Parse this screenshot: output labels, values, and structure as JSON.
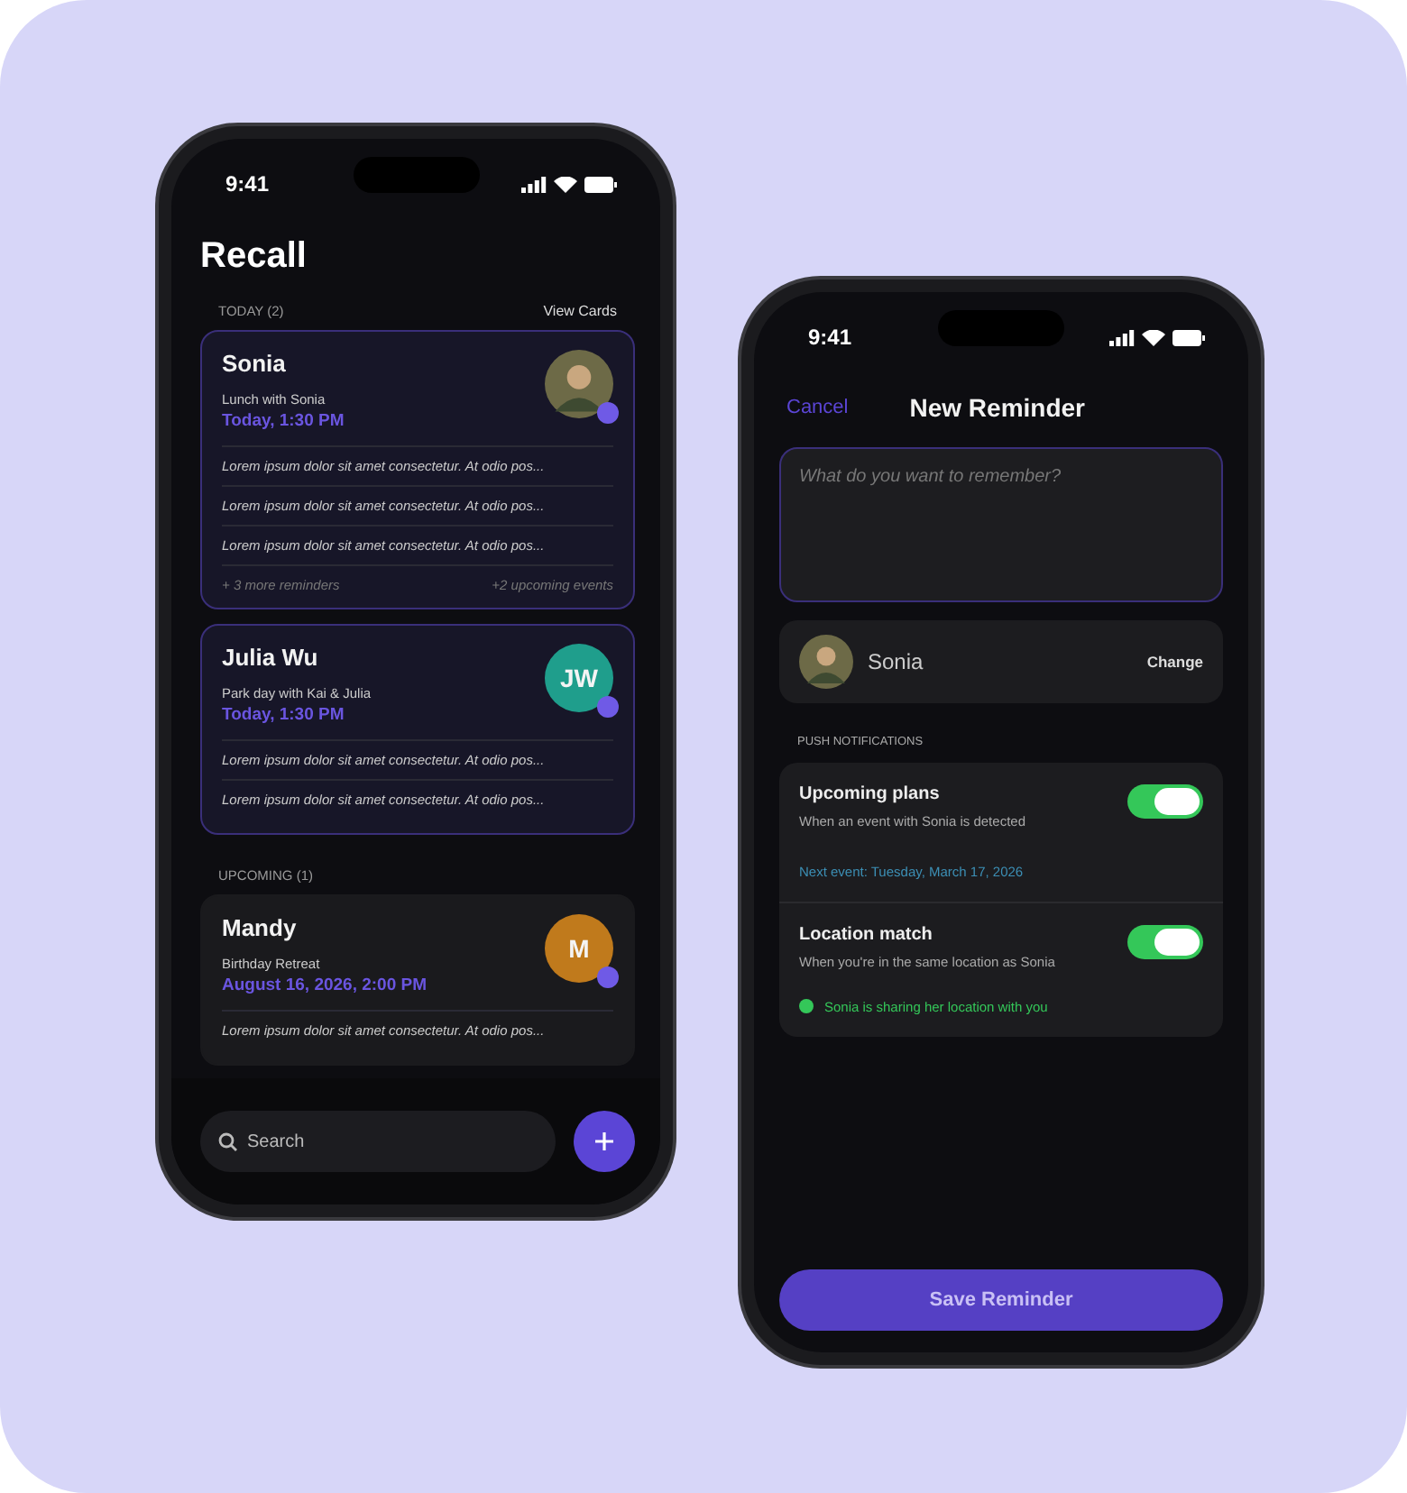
{
  "recall": {
    "status_time": "9:41",
    "title": "Recall",
    "sections": [
      {
        "kind": "today",
        "label": "TODAY (2)",
        "action": "View Cards",
        "cards": [
          {
            "name": "Sonia",
            "event": "Lunch with Sonia",
            "when": "Today, 1:30 PM",
            "avatar": {
              "kind": "photo"
            },
            "notes": [
              "Lorem ipsum dolor sit amet consectetur. At odio pos...",
              "Lorem ipsum dolor sit amet consectetur. At odio pos...",
              "Lorem ipsum dolor sit amet consectetur. At odio pos..."
            ],
            "more": "+ 3 more reminders",
            "upcoming": "+2 upcoming events"
          },
          {
            "name": "Julia Wu",
            "event": "Park day with Kai & Julia",
            "when": "Today, 1:30 PM",
            "avatar": {
              "kind": "initials",
              "initials": "JW",
              "color": "#1f9e8c"
            },
            "notes": [
              "Lorem ipsum dolor sit amet consectetur. At odio pos...",
              "Lorem ipsum dolor sit amet consectetur. At odio pos..."
            ]
          }
        ]
      },
      {
        "kind": "upcoming",
        "label": "UPCOMING (1)",
        "cards": [
          {
            "name": "Mandy",
            "event": "Birthday Retreat",
            "when": "August 16, 2026, 2:00 PM",
            "avatar": {
              "kind": "initials",
              "initials": "M",
              "color": "#c07a1c"
            },
            "notes": [
              "Lorem ipsum dolor sit amet consectetur. At odio pos..."
            ]
          }
        ]
      }
    ],
    "search": {
      "placeholder": "Search"
    }
  },
  "new_reminder": {
    "status_time": "9:41",
    "cancel": "Cancel",
    "title": "New Reminder",
    "input": {
      "placeholder": "What do you want to remember?"
    },
    "contact": {
      "name": "Sonia",
      "action": "Change"
    },
    "section_label": "PUSH NOTIFICATIONS",
    "notifications": [
      {
        "title": "Upcoming plans",
        "description": "When an event with Sonia is detected",
        "on": true,
        "note": "Next event: Tuesday, March 17, 2026",
        "kind": "info"
      },
      {
        "title": "Location match",
        "description": "When you're in the same location as Sonia",
        "on": true,
        "note": "Sonia is sharing her location with you",
        "kind": "status"
      }
    ],
    "save": "Save Reminder"
  }
}
